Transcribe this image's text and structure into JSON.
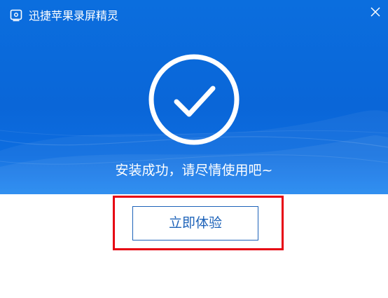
{
  "window": {
    "title": "迅捷苹果录屏精灵",
    "app_icon": "screen-record-icon",
    "close_icon": "close-icon"
  },
  "hero": {
    "status_icon": "checkmark-circle-icon",
    "message": "安装成功，请尽情使用吧~"
  },
  "actions": {
    "primary_label": "立即体验"
  },
  "colors": {
    "hero_blue": "#0a66d8",
    "button_text": "#1e63b9",
    "highlight": "#e60012"
  }
}
